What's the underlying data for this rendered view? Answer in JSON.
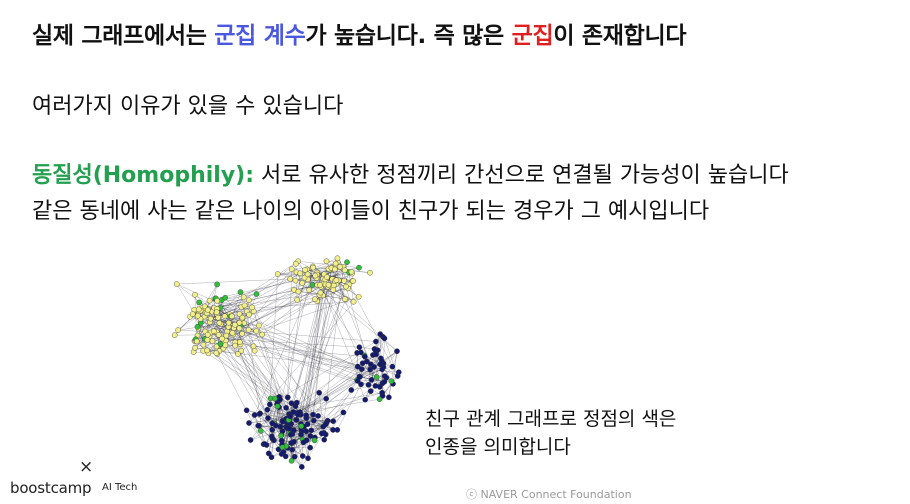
{
  "title": {
    "t1": "실제 그래프에서는 ",
    "t2": "군집 계수",
    "t3": "가 높습니다. 즉 많은 ",
    "t4": "군집",
    "t5": "이 존재합니다"
  },
  "reasons": "여러가지 이유가 있을 수 있습니다",
  "homophily": {
    "term": "동질성(Homophily):",
    "text": " 서로 유사한 정점끼리 간선으로 연결될 가능성이 높습니다"
  },
  "example": "같은 동네에 사는 같은 나이의 아이들이 친구가 되는 경우가 그 예시입니다",
  "caption": {
    "line1": "친구 관계 그래프로 정점의 색은",
    "line2": "인종을 의미합니다"
  },
  "brand": {
    "close": "×",
    "name": "boostcamp",
    "sub": "AI Tech"
  },
  "copyright": "ⓒ NAVER Connect Foundation",
  "colors": {
    "highlight_blue": "#4a57e0",
    "highlight_red": "#e01f1f",
    "homophily_green": "#23a04f",
    "node_yellow": "#f3f08a",
    "node_navy": "#141a6e",
    "node_green": "#2fbf3a"
  }
}
